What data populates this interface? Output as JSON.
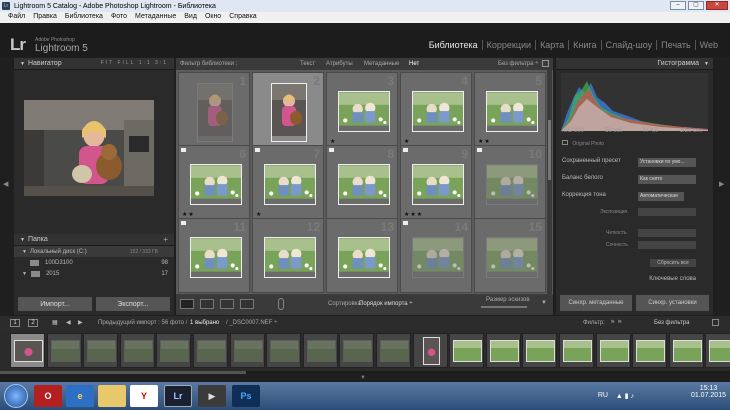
{
  "window": {
    "title": "Lightroom 5 Catalog - Adobe Photoshop Lightroom - Библиотека",
    "icon_label": "Lr",
    "buttons": [
      "–",
      "▢",
      "✕"
    ]
  },
  "menu": [
    "Файл",
    "Правка",
    "Библиотека",
    "Фото",
    "Метаданные",
    "Вид",
    "Окно",
    "Справка"
  ],
  "identity": {
    "logo": "Lr",
    "small": "Adobe Photoshop",
    "big": "Lightroom 5"
  },
  "modules": [
    "Библиотека",
    "Коррекции",
    "Карта",
    "Книга",
    "Слайд-шоу",
    "Печать",
    "Web"
  ],
  "navigator": {
    "title": "Навигатор",
    "options": "FIT  FILL  1:1  3:1"
  },
  "folders": {
    "title": "Папка",
    "disk": {
      "label": "Локальный диск (C:)",
      "space": "192 / 333 ГБ"
    },
    "items": [
      {
        "label": "100D3100",
        "count": "98"
      },
      {
        "label": "2015",
        "count": "17"
      }
    ]
  },
  "left_buttons": {
    "import": "Импорт...",
    "export": "Экспорт..."
  },
  "filterbar": {
    "title": "Фильтр библиотеки :",
    "items": [
      "Текст",
      "Атрибуты",
      "Метаданные",
      "Нет"
    ],
    "preset": "Без фильтра ÷"
  },
  "grid": {
    "numbers": [
      "1",
      "2",
      "3",
      "4",
      "5",
      "6",
      "7",
      "8",
      "9",
      "10",
      "11",
      "12",
      "13",
      "14",
      "15"
    ],
    "stars": [
      "",
      "",
      "★",
      "★",
      "★★",
      "★★",
      "★",
      "",
      "★★★",
      "",
      "",
      "",
      "",
      "",
      ""
    ]
  },
  "toolbar": {
    "sort_label": "Сортировка:",
    "sort_value": "Порядок импорта ÷",
    "size_label": "Размер эскизов"
  },
  "histogram": {
    "title": "Гистограмма",
    "iso": "ISO 800",
    "focal": "50 мм",
    "aperture": "f / 4,0",
    "shutter": "1/50 сек",
    "original": "Original Photo"
  },
  "quick": {
    "saved_preset_label": "Сохраненный пресет",
    "saved_preset_value": "Установки по умо...",
    "wb_label": "Баланс белого",
    "wb_value": "Как снято",
    "tone_label": "Коррекция тона",
    "tone_value": "Автоматическая",
    "exposure": "Экспозиция",
    "clarity": "Четкость",
    "vibrance": "Сочность",
    "reset": "Сбросить все",
    "keywords": "Ключевые слова"
  },
  "sync": {
    "metadata": "Синхр. метаданные",
    "settings": "Синхр. установки"
  },
  "filmhead": {
    "pages": [
      "1",
      "2"
    ],
    "info": "Предыдущий импорт : 56 фото /",
    "selected": "1 выбрано",
    "file": "/ _DSC0007.NEF ÷",
    "filter_label": "Фильтр:",
    "filter_value": "Без фильтра"
  },
  "taskbar": {
    "lang": "RU",
    "time": "15:13",
    "date": "01.07.2015",
    "apps": [
      "O",
      "e",
      "",
      "Y",
      "Lr",
      "",
      "Ps"
    ]
  }
}
